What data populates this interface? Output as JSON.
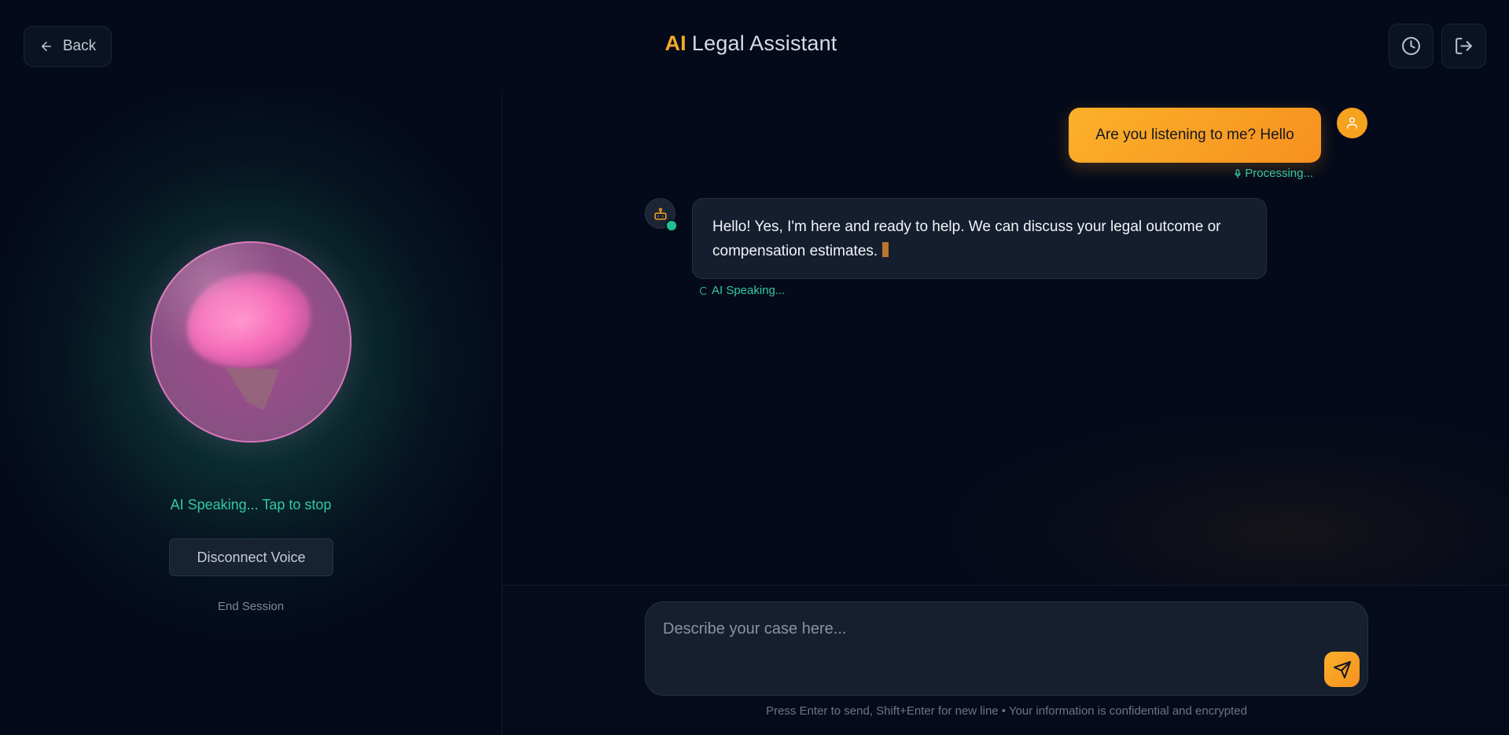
{
  "header": {
    "back_label": "Back",
    "title_accent": "AI",
    "title_rest": "Legal Assistant",
    "history_icon": "clock-icon",
    "logout_icon": "logout-icon"
  },
  "voice_panel": {
    "status": "AI Speaking... Tap to stop",
    "disconnect_label": "Disconnect Voice",
    "end_session_label": "End Session"
  },
  "chat": {
    "messages": [
      {
        "role": "user",
        "text": "Are you listening to me? Hello",
        "status": "Processing..."
      },
      {
        "role": "assistant",
        "text": "Hello! Yes, I'm here and ready to help. We can discuss your legal outcome or compensation estimates.",
        "status": "AI Speaking..."
      }
    ]
  },
  "input": {
    "placeholder": "Describe your case here...",
    "value": "",
    "hint": "Press Enter to send, Shift+Enter for new line • Your information is confidential and encrypted"
  },
  "colors": {
    "accent": "#f6a823",
    "speaking": "#34c8a0",
    "background": "#040a1a"
  }
}
